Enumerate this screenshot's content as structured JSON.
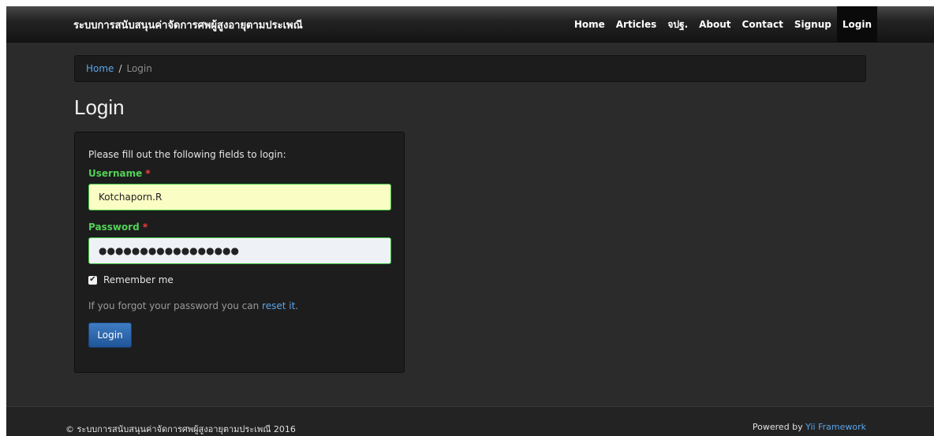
{
  "navbar": {
    "brand": "ระบบการสนับสนุนค่าจัดการศพผู้สูงอายุตามประเพณี",
    "items": [
      {
        "label": "Home"
      },
      {
        "label": "Articles"
      },
      {
        "label": "จปฐ."
      },
      {
        "label": "About"
      },
      {
        "label": "Contact"
      },
      {
        "label": "Signup"
      },
      {
        "label": "Login",
        "active": true
      }
    ]
  },
  "breadcrumb": {
    "home": "Home",
    "separator": "/",
    "current": "Login"
  },
  "page_title": "Login",
  "form": {
    "intro": "Please fill out the following fields to login:",
    "username_label": "Username",
    "username_value": "Kotchaporn.R",
    "password_label": "Password",
    "password_value": "●●●●●●●●●●●●●●●●●",
    "required_mark": "*",
    "remember_label": "Remember me",
    "remember_checked": true,
    "forgot_text": "If you forgot your password you can",
    "reset_link": "reset it",
    "forgot_suffix": ".",
    "submit_label": "Login"
  },
  "footer": {
    "copyright": "© ระบบการสนับสนุนค่าจัดการศพผู้สูงอายุตามประเพณี 2016",
    "powered_prefix": "Powered by",
    "powered_link": "Yii Framework"
  },
  "colors": {
    "background": "#2b2b2b",
    "link": "#5aa5ea",
    "success": "#52d157",
    "required": "#ff3a3a",
    "button": "#205599"
  }
}
